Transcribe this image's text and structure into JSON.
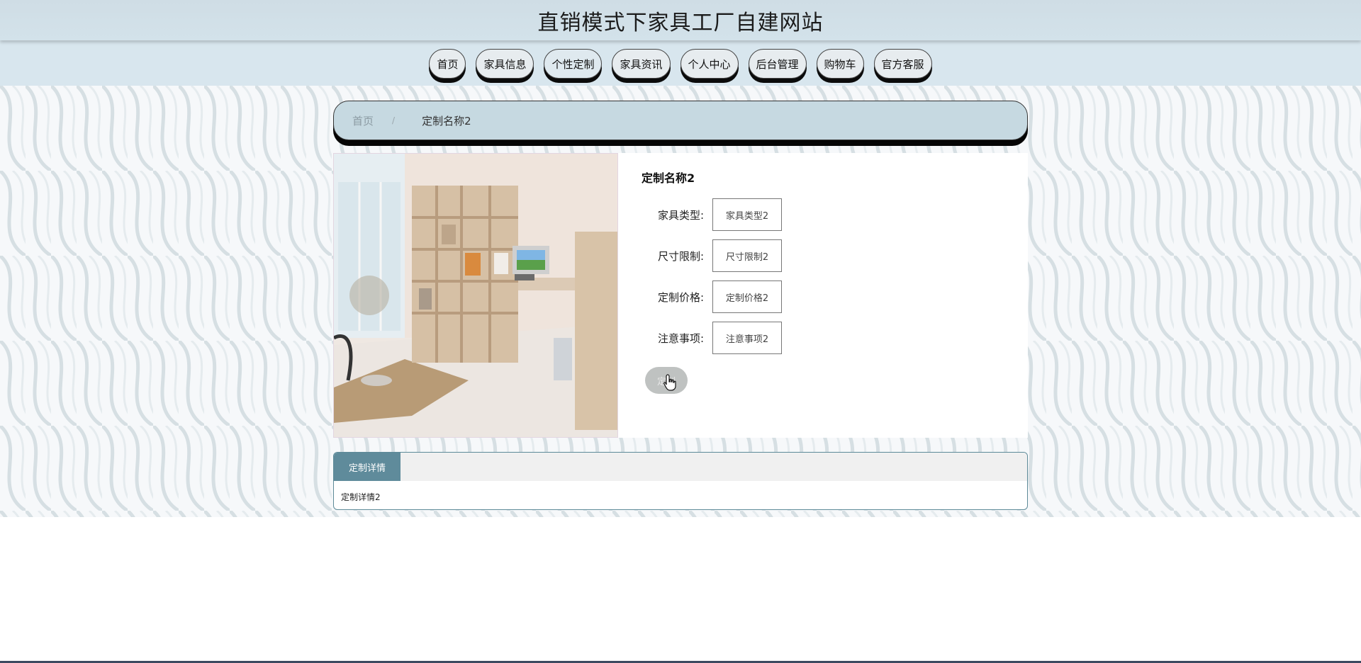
{
  "header": {
    "title": "直销模式下家具工厂自建网站"
  },
  "nav": {
    "items": [
      {
        "label": "首页"
      },
      {
        "label": "家具信息"
      },
      {
        "label": "个性定制"
      },
      {
        "label": "家具资讯"
      },
      {
        "label": "个人中心"
      },
      {
        "label": "后台管理"
      },
      {
        "label": "购物车"
      },
      {
        "label": "官方客服"
      }
    ]
  },
  "breadcrumb": {
    "home": "首页",
    "separator": "/",
    "current": "定制名称2"
  },
  "detail": {
    "name": "定制名称2",
    "fields": [
      {
        "label": "家具类型:",
        "value": "家具类型2"
      },
      {
        "label": "尺寸限制:",
        "value": "尺寸限制2"
      },
      {
        "label": "定制价格:",
        "value": "定制价格2"
      },
      {
        "label": "注意事项:",
        "value": "注意事项2"
      }
    ],
    "button_label": "定制"
  },
  "tabs": {
    "items": [
      {
        "label": "定制详情"
      }
    ],
    "content": "定制详情2"
  }
}
